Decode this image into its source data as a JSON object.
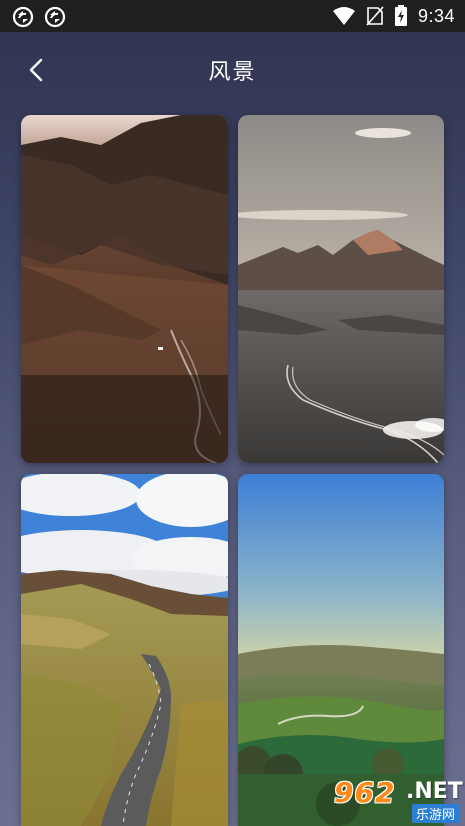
{
  "status_bar": {
    "time": "9:34",
    "icons": [
      "sync-icon",
      "sync-icon",
      "wifi-icon",
      "no-sim-icon",
      "battery-charging-icon"
    ]
  },
  "header": {
    "back_icon": "chevron-left-icon",
    "title": "风景"
  },
  "gallery": {
    "items": [
      {
        "scene": "desert-canyon-road"
      },
      {
        "scene": "mountain-plain-road"
      },
      {
        "scene": "grassland-road-clouds"
      },
      {
        "scene": "green-hills-sunset"
      }
    ]
  },
  "watermark": {
    "number": "962",
    "suffix": ".NET",
    "cn": "乐游网"
  },
  "colors": {
    "background": "#3e4465",
    "status_bar": "#1f2022",
    "watermark_orange": "#ff8a1a"
  }
}
